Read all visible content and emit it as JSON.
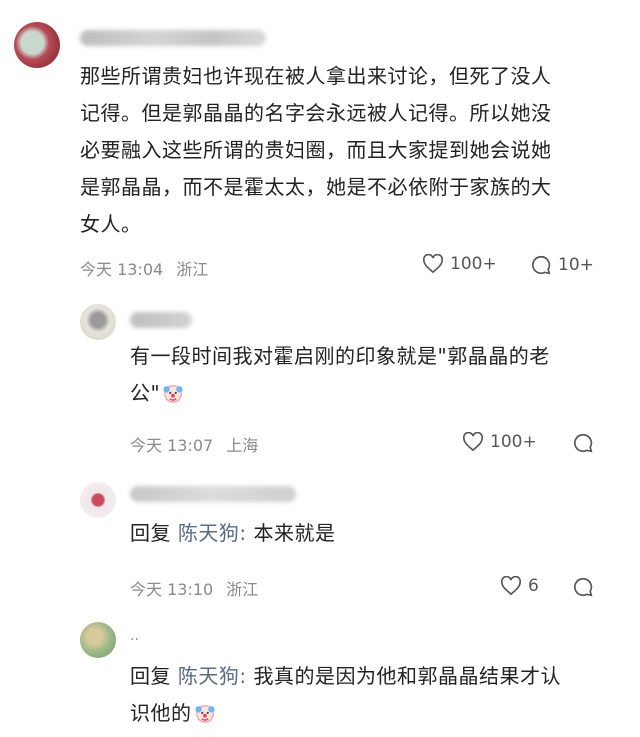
{
  "comments": [
    {
      "text": "那些所谓贵妇也许现在被人拿出来讨论，但死了没人记得。但是郭晶晶的名字会永远被人记得。所以她没必要融入这些所谓的贵妇圈，而且大家提到她会说她是郭晶晶，而不是霍太太，她是不必依附于家族的大女人。",
      "lines": [
        "那些所谓贵妇也许现在被人拿出来讨论，但死了没人",
        "记得。但是郭晶晶的名字会永远被人记得。所以她没",
        "必要融入这些所谓的贵妇圈，而且大家提到她会说她",
        "是郭晶晶，而不是霍太太，她是不必依附于家族的大",
        "女人。"
      ],
      "time": "今天 13:04",
      "location": "浙江",
      "likes": "100+",
      "replies": "10+"
    }
  ],
  "reply1": {
    "lines": [
      "有一段时间我对霍启刚的印象就是\"郭晶晶的老",
      "公\""
    ],
    "time": "今天 13:07",
    "location": "上海",
    "likes": "100+"
  },
  "reply2": {
    "reply_label": "回复",
    "target": "陈天狗:",
    "text": "本来就是",
    "time": "今天 13:10",
    "location": "浙江",
    "likes": "6"
  },
  "reply3": {
    "reply_label": "回复",
    "target": "陈天狗:",
    "text_line1": "我真的是因为他和郭晶晶结果才认",
    "text_line2": "识他的",
    "name_visible": "..",
    "time": "",
    "location": ""
  },
  "icons": {
    "like": "heart-icon",
    "comment": "comment-bubble-icon",
    "emoji": "clown-face-emoji"
  },
  "colors": {
    "text": "#222222",
    "meta": "#8a8a8a",
    "reply_target": "#5a6b86"
  }
}
